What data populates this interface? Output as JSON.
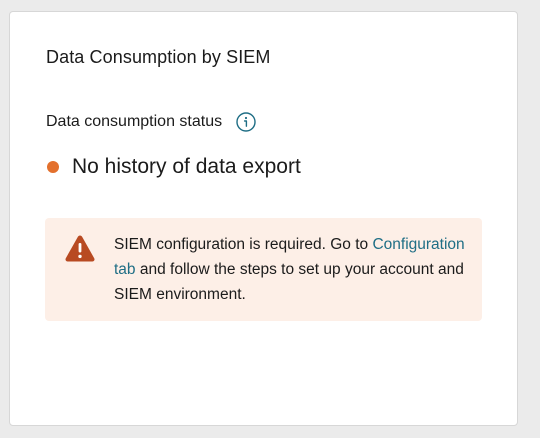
{
  "card": {
    "title": "Data Consumption by SIEM"
  },
  "status": {
    "label": "Data consumption status",
    "info_icon": "info-icon",
    "value": "No history of data export",
    "dot_color": "#e3702d"
  },
  "alert": {
    "icon": "warning-icon",
    "icon_color": "#b84a22",
    "background_color": "#fdefe7",
    "text_before_link": "SIEM configuration is required. Go to",
    "link_text": "Configuration tab",
    "link_color": "#1f6e85",
    "text_after_link": "and follow the steps to set up your account and SIEM environment."
  }
}
